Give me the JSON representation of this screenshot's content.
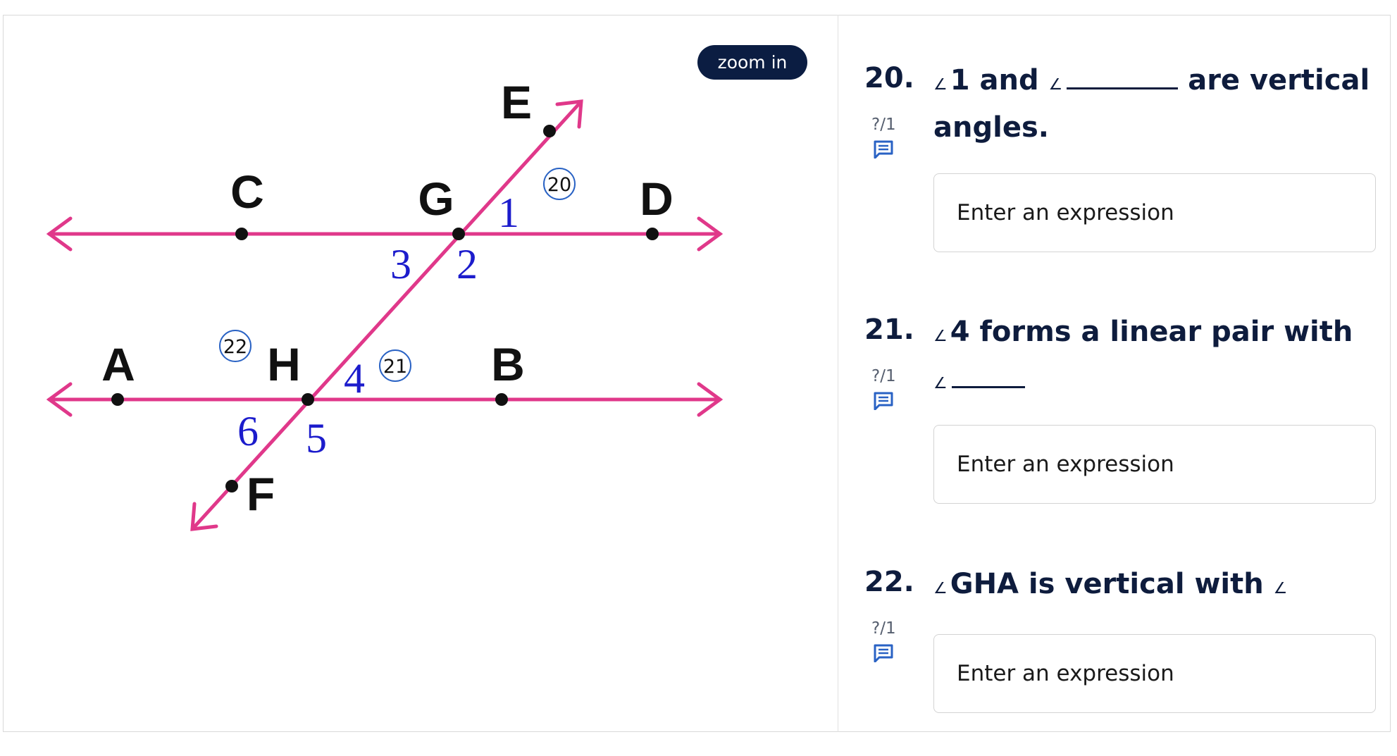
{
  "figure": {
    "points": {
      "C": "C",
      "G": "G",
      "D": "D",
      "E": "E",
      "A": "A",
      "H": "H",
      "B": "B",
      "F": "F"
    },
    "angles": {
      "a1": "1",
      "a2": "2",
      "a3": "3",
      "a4": "4",
      "a5": "5",
      "a6": "6"
    },
    "markers": {
      "m20": "20",
      "m21": "21",
      "m22": "22"
    },
    "colors": {
      "lines": "#e0388a",
      "angle_numbers": "#1c1ccc",
      "points": "#111111"
    }
  },
  "zoom_button": {
    "label": "zoom in"
  },
  "questions": [
    {
      "number": "20.",
      "score": "?/1",
      "pre": "1 and",
      "post": "are vertical angles.",
      "placeholder": "Enter an expression"
    },
    {
      "number": "21.",
      "score": "?/1",
      "pre": "4 forms a linear pair with",
      "post": "",
      "placeholder": "Enter an expression"
    },
    {
      "number": "22.",
      "score": "?/1",
      "pre": "GHA is vertical with",
      "post": "",
      "placeholder": "Enter an expression"
    }
  ],
  "angle_symbol": "∠",
  "icons": {
    "feedback": "comment-icon"
  },
  "accent_color": "#2962c4"
}
